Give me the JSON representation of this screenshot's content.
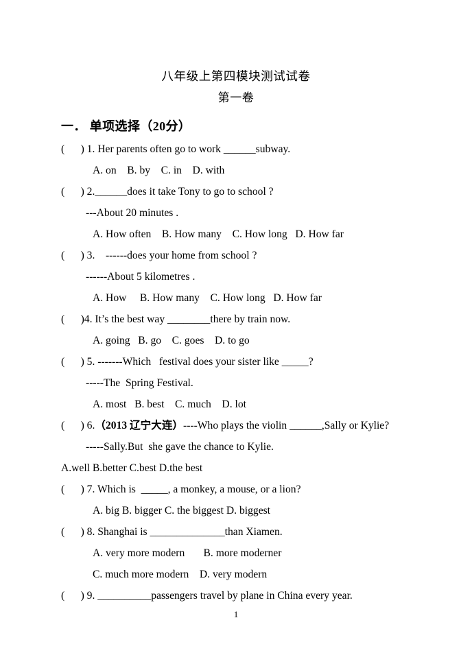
{
  "document": {
    "title": "八年级上第四模块测试试卷",
    "subtitle": "第一卷",
    "page_number": "1"
  },
  "section": {
    "heading": "一．  单项选择（20分）"
  },
  "questions": [
    {
      "stem": "(      ) 1. Her parents often go to work ______subway.",
      "answer": null,
      "options": [
        "A. on    B. by    C. in    D. with"
      ],
      "options_indent": "opts"
    },
    {
      "stem": "(      ) 2.______does it take Tony to go to school ?",
      "answer": "---About 20 minutes .",
      "options": [
        "A. How often    B. How many    C. How long   D. How far"
      ],
      "options_indent": "opts"
    },
    {
      "stem": "(      ) 3.    ------does your home from school ?",
      "answer": "------About 5 kilometres .",
      "options": [
        "A. How     B. How many    C. How long   D. How far"
      ],
      "options_indent": "opts"
    },
    {
      "stem": "(      )4. It’s the best way ________there by train now.",
      "answer": null,
      "options": [
        "A. going   B. go    C. goes    D. to go"
      ],
      "options_indent": "opts"
    },
    {
      "stem": "(      ) 5. -------Which   festival does your sister like _____?",
      "answer": "-----The  Spring Festival.",
      "options": [
        "A. most   B. best    C. much    D. lot"
      ],
      "options_indent": "opts"
    },
    {
      "stem_prefix": "(      ) 6.",
      "stem_bold": "（2013 辽宁大连）",
      "stem_suffix": "----Who plays the violin ______,Sally or Kylie?",
      "answer": "-----Sally.But  she gave the chance to Kylie.",
      "options": [
        "A.well B.better C.best D.the best"
      ],
      "options_indent": "opts-flush"
    },
    {
      "stem": "(      ) 7. Which is  _____, a monkey, a mouse, or a lion?",
      "answer": null,
      "options": [
        "A. big B. bigger C. the biggest D. biggest"
      ],
      "options_indent": "opts"
    },
    {
      "stem": "(      ) 8. Shanghai is ______________than Xiamen.",
      "answer": null,
      "options": [
        "A. very more modern       B. more moderner",
        "C. much more modern    D. very modern"
      ],
      "options_indent": "opts"
    },
    {
      "stem": "(      ) 9. __________passengers travel by plane in China every year.",
      "answer": null,
      "options": [],
      "options_indent": "opts"
    }
  ]
}
